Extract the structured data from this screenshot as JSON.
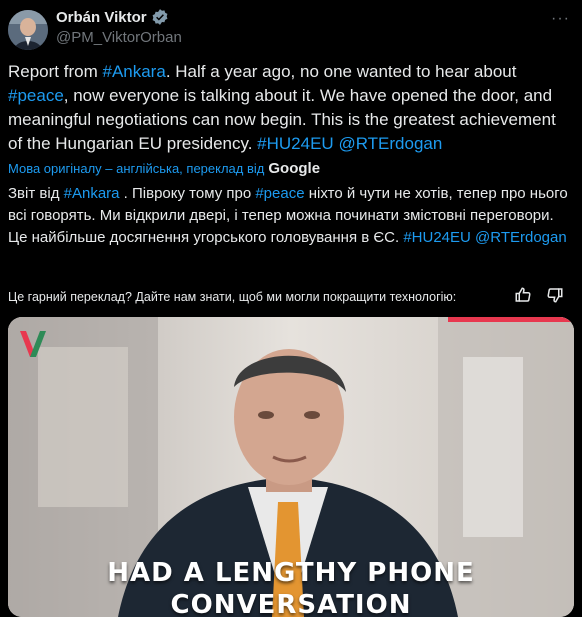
{
  "author": {
    "name": "Orbán Viktor",
    "handle": "@PM_ViktorOrban"
  },
  "tweet": {
    "segments": [
      {
        "text": "Report from ",
        "link": false
      },
      {
        "text": "#Ankara",
        "link": true
      },
      {
        "text": ". Half a year ago, no one wanted to hear about ",
        "link": false
      },
      {
        "text": "#peace",
        "link": true
      },
      {
        "text": ", now everyone is talking about it. We have opened the door, and meaningful negotiations can now begin. This is the greatest achievement of the Hungarian EU presidency. ",
        "link": false
      },
      {
        "text": "#HU24EU",
        "link": true
      },
      {
        "text": " ",
        "link": false
      },
      {
        "text": "@RTErdogan",
        "link": true
      }
    ]
  },
  "translation": {
    "label": "Мова оригіналу – англійська, переклад від",
    "provider": "Google",
    "segments": [
      {
        "text": "Звіт від ",
        "link": false
      },
      {
        "text": "#Ankara",
        "link": true
      },
      {
        "text": " . Півроку тому про ",
        "link": false
      },
      {
        "text": "#peace",
        "link": true
      },
      {
        "text": " ніхто й чути не хотів, тепер про нього всі говорять. Ми відкрили двері, і тепер можна починати змістовні переговори. Це найбільше досягнення угорського головування в ЄС. ",
        "link": false
      },
      {
        "text": "#HU24EU",
        "link": true
      },
      {
        "text": " ",
        "link": false
      },
      {
        "text": "@RTErdogan",
        "link": true
      }
    ],
    "feedback_prompt": "Це гарний переклад? Дайте нам знати, щоб ми могли покращити технологію:"
  },
  "video": {
    "caption_line1": "HAD A LENGTHY PHONE",
    "caption_line2": "CONVERSATION"
  },
  "colors": {
    "link": "#1d9bf0",
    "verified": "#829aab",
    "muted": "#71767b",
    "flag_red": "#e8384f",
    "flag_green": "#2e8b57"
  },
  "icons": {
    "verified": "verified-badge-icon",
    "more": "more-options-icon",
    "thumbs_up": "thumbs-up-icon",
    "thumbs_down": "thumbs-down-icon",
    "logo": "channel-logo-icon"
  }
}
